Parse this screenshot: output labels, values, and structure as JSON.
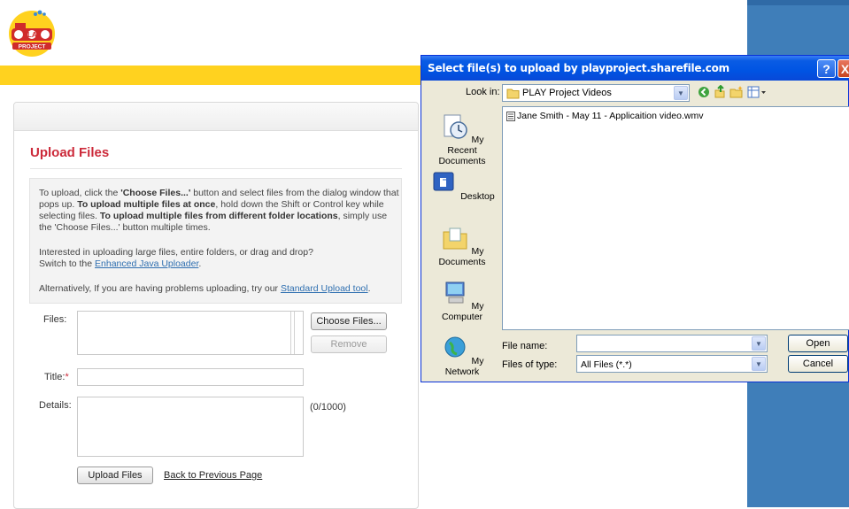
{
  "logo": {
    "text": "PLAY",
    "subtext": "PROJECT"
  },
  "upload": {
    "title": "Upload Files",
    "info": {
      "p1_a": "To upload, click the ",
      "p1_b": "'Choose Files...'",
      "p1_c": " button and select files from the dialog window that pops up. ",
      "p1_d": "To upload multiple files at once",
      "p1_e": ", hold down the Shift or Control key while selecting files. ",
      "p1_f": "To upload multiple files from different folder locations",
      "p1_g": ", simply use the 'Choose Files...' button multiple times.",
      "p2_a": "Interested in uploading large files, entire folders, or drag and drop?",
      "p2_b": "Switch to the ",
      "p2_link": "Enhanced Java Uploader",
      "p2_end": ".",
      "p3_a": "Alternatively, If you are having problems uploading, try our ",
      "p3_link": "Standard Upload tool",
      "p3_end": "."
    },
    "files_label": "Files:",
    "choose_button": "Choose Files...",
    "remove_button": "Remove",
    "title_label": "Title:",
    "required_mark": "*",
    "details_label": "Details:",
    "char_count": "(0/1000)",
    "upload_button": "Upload Files",
    "back_link": "Back to Previous Page"
  },
  "dialog": {
    "title": "Select file(s) to upload by playproject.sharefile.com",
    "help_button": "?",
    "close_button": "X",
    "lookin_label": "Look in:",
    "lookin_value": "PLAY Project Videos",
    "places": [
      {
        "label": "My Recent Documents"
      },
      {
        "label": "Desktop"
      },
      {
        "label": "My Documents"
      },
      {
        "label": "My Computer"
      },
      {
        "label": "My Network"
      }
    ],
    "files": [
      "Jane Smith - May 11 - Applicaition video.wmv"
    ],
    "filename_label": "File name:",
    "filename_value": "",
    "filetype_label": "Files of type:",
    "filetype_value": "All Files (*.*)",
    "open_button": "Open",
    "cancel_button": "Cancel"
  },
  "colors": {
    "banner": "#ffd21f",
    "accent_red": "#cc2a3a",
    "link_blue": "#2f6fb0",
    "side_blue": "#3f7eb9",
    "xp_title": "#0054e3"
  }
}
